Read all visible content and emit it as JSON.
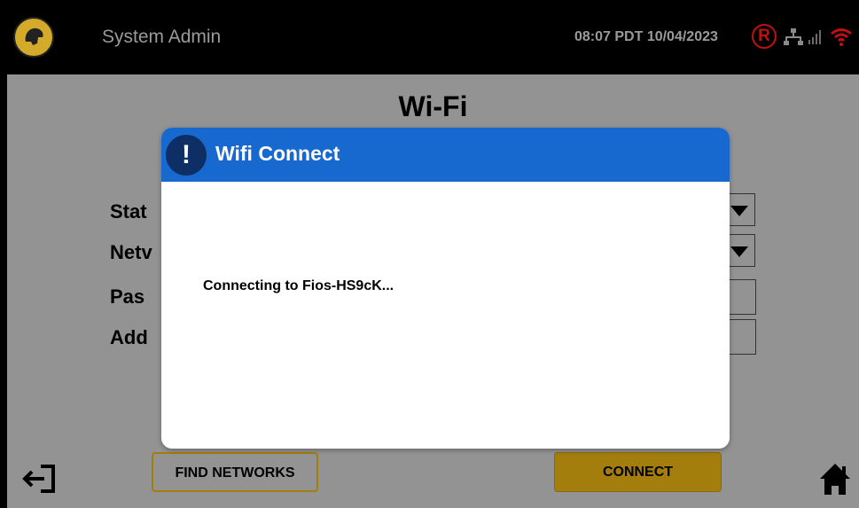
{
  "header": {
    "app_title": "System Admin",
    "datetime": "08:07 PDT 10/04/2023",
    "registered_badge": "R",
    "icons": [
      "logo-icon",
      "registered-icon",
      "lan-icon",
      "signal-icon",
      "wifi-icon"
    ]
  },
  "page": {
    "title": "Wi-Fi",
    "labels": [
      "Stat",
      "Netv",
      "Pas",
      "Add"
    ]
  },
  "buttons": {
    "find_networks": "FIND NETWORKS",
    "connect": "CONNECT"
  },
  "dialog": {
    "title": "Wifi Connect",
    "alert_glyph": "!",
    "message": "Connecting to Fios-HS9cK..."
  },
  "colors": {
    "background": "#939393",
    "topbar": "#000000",
    "accent_gold": "#a47e0d",
    "dialog_header": "#1769cf",
    "alert_red": "#c01010"
  }
}
